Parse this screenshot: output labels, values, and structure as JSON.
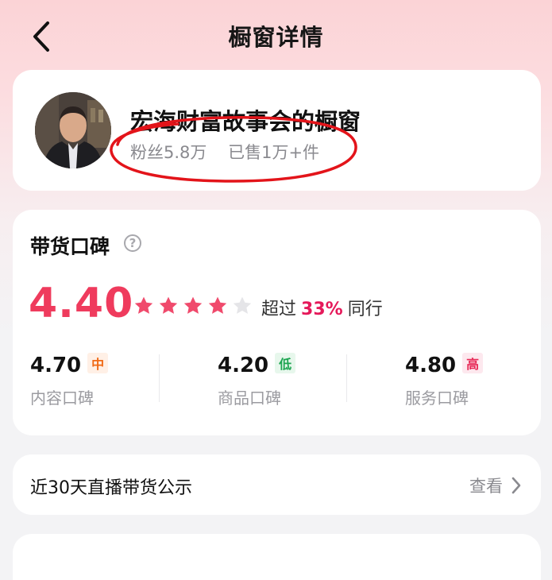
{
  "header": {
    "title": "橱窗详情",
    "back_icon": "chevron-left-icon"
  },
  "shop": {
    "name": "宏海财富故事会的橱窗",
    "fans": "粉丝5.8万",
    "sold": "已售1万+件",
    "avatar_icon": "avatar-photo",
    "annotation_color": "#e3141a"
  },
  "rating": {
    "title": "带货口碑",
    "help_icon": "question-circle-icon",
    "score": "4.40",
    "stars_filled": 4,
    "stars_total": 5,
    "exceed_prefix": "超过",
    "exceed_percent": "33%",
    "exceed_suffix": "同行",
    "metrics": [
      {
        "value": "4.70",
        "badge": "中",
        "label": "内容口碑"
      },
      {
        "value": "4.20",
        "badge": "低",
        "label": "商品口碑"
      },
      {
        "value": "4.80",
        "badge": "高",
        "label": "服务口碑"
      }
    ]
  },
  "live": {
    "title": "近30天直播带货公示",
    "view_more": "查看",
    "chevron_icon": "chevron-right-icon"
  },
  "colors": {
    "accent": "#ef3b5d",
    "star": "#f04a6c",
    "star_empty": "#e5e5e8"
  }
}
